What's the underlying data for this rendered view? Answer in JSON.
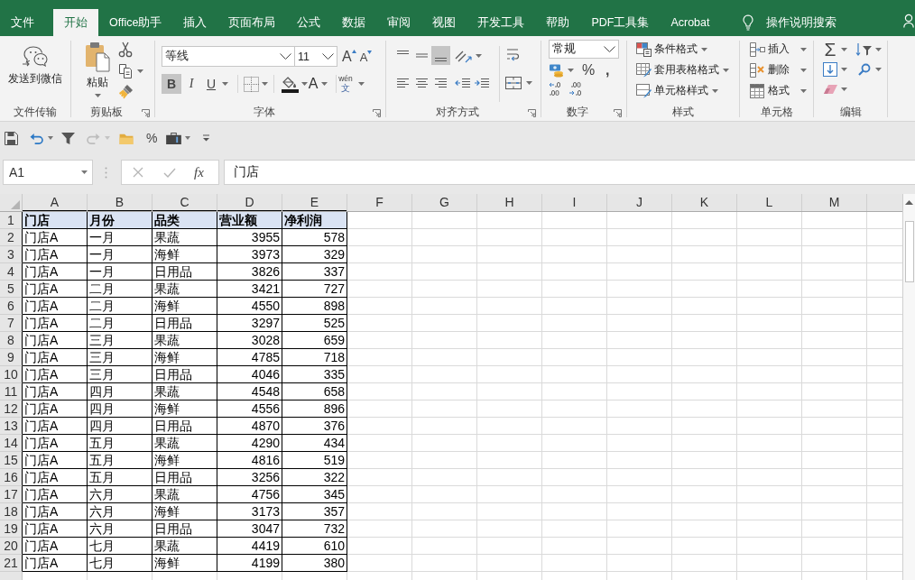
{
  "tabs": [
    {
      "label": "文件",
      "selected": false
    },
    {
      "label": "开始",
      "selected": true
    },
    {
      "label": "Office助手",
      "selected": false
    },
    {
      "label": "插入",
      "selected": false
    },
    {
      "label": "页面布局",
      "selected": false
    },
    {
      "label": "公式",
      "selected": false
    },
    {
      "label": "数据",
      "selected": false
    },
    {
      "label": "审阅",
      "selected": false
    },
    {
      "label": "视图",
      "selected": false
    },
    {
      "label": "开发工具",
      "selected": false
    },
    {
      "label": "帮助",
      "selected": false
    },
    {
      "label": "PDF工具集",
      "selected": false
    },
    {
      "label": "Acrobat",
      "selected": false
    }
  ],
  "tell_me": {
    "label": "操作说明搜索"
  },
  "ribbon": {
    "file_transfer": {
      "title": "文件传输",
      "send_label": "发送到微信"
    },
    "clipboard": {
      "title": "剪贴板",
      "paste_label": "粘贴"
    },
    "font": {
      "title": "字体",
      "font_name": "等线",
      "font_size": "11",
      "grow_label": "A",
      "shrink_label": "A",
      "format_buttons": [
        {
          "kind": "bold",
          "label": "B",
          "on": true,
          "menu": false
        },
        {
          "kind": "italic",
          "label": "I",
          "on": false,
          "menu": false
        },
        {
          "kind": "underline",
          "label": "U",
          "on": false,
          "menu": true
        }
      ],
      "font_color_label": "A",
      "phonetic": {
        "pinyin": "wén",
        "char": "文"
      }
    },
    "alignment": {
      "title": "对齐方式",
      "vertical": [
        {
          "kind": "top",
          "on": false
        },
        {
          "kind": "middle",
          "on": false
        },
        {
          "kind": "bottom",
          "on": true
        }
      ]
    },
    "number": {
      "title": "数字",
      "format": "常规",
      "percent_label": "%",
      "comma_label": ","
    },
    "styles": {
      "title": "样式",
      "items": [
        {
          "kind": "conditional",
          "label": "条件格式"
        },
        {
          "kind": "table",
          "label": "套用表格格式"
        },
        {
          "kind": "cell",
          "label": "单元格样式"
        }
      ]
    },
    "cells": {
      "title": "单元格",
      "items": [
        {
          "kind": "insert",
          "label": "插入"
        },
        {
          "kind": "delete",
          "label": "删除"
        },
        {
          "kind": "format",
          "label": "格式"
        }
      ]
    },
    "editing": {
      "title": "编辑",
      "sum_label": "Σ"
    }
  },
  "quick_access": {
    "percent_label": "%",
    "redo_disabled": true
  },
  "formula_bar": {
    "name_box": "A1",
    "function_label": "fx",
    "value": "门店",
    "editing": false
  },
  "sheet": {
    "columns": [
      "A",
      "B",
      "C",
      "D",
      "E",
      "F",
      "G",
      "H",
      "I",
      "J",
      "K",
      "L",
      "M"
    ],
    "header": {
      "number": "1",
      "cells": [
        {
          "text": "门店",
          "kind": "text"
        },
        {
          "text": "月份",
          "kind": "text"
        },
        {
          "text": "品类",
          "kind": "text"
        },
        {
          "text": "营业额",
          "kind": "number"
        },
        {
          "text": "净利润",
          "kind": "number"
        }
      ]
    },
    "rows": [
      {
        "number": "2",
        "cells": [
          "门店A",
          "一月",
          "果蔬",
          "3955",
          "578"
        ]
      },
      {
        "number": "3",
        "cells": [
          "门店A",
          "一月",
          "海鲜",
          "3973",
          "329"
        ]
      },
      {
        "number": "4",
        "cells": [
          "门店A",
          "一月",
          "日用品",
          "3826",
          "337"
        ]
      },
      {
        "number": "5",
        "cells": [
          "门店A",
          "二月",
          "果蔬",
          "3421",
          "727"
        ]
      },
      {
        "number": "6",
        "cells": [
          "门店A",
          "二月",
          "海鲜",
          "4550",
          "898"
        ]
      },
      {
        "number": "7",
        "cells": [
          "门店A",
          "二月",
          "日用品",
          "3297",
          "525"
        ]
      },
      {
        "number": "8",
        "cells": [
          "门店A",
          "三月",
          "果蔬",
          "3028",
          "659"
        ]
      },
      {
        "number": "9",
        "cells": [
          "门店A",
          "三月",
          "海鲜",
          "4785",
          "718"
        ]
      },
      {
        "number": "10",
        "cells": [
          "门店A",
          "三月",
          "日用品",
          "4046",
          "335"
        ]
      },
      {
        "number": "11",
        "cells": [
          "门店A",
          "四月",
          "果蔬",
          "4548",
          "658"
        ]
      },
      {
        "number": "12",
        "cells": [
          "门店A",
          "四月",
          "海鲜",
          "4556",
          "896"
        ]
      },
      {
        "number": "13",
        "cells": [
          "门店A",
          "四月",
          "日用品",
          "4870",
          "376"
        ]
      },
      {
        "number": "14",
        "cells": [
          "门店A",
          "五月",
          "果蔬",
          "4290",
          "434"
        ]
      },
      {
        "number": "15",
        "cells": [
          "门店A",
          "五月",
          "海鲜",
          "4816",
          "519"
        ]
      },
      {
        "number": "16",
        "cells": [
          "门店A",
          "五月",
          "日用品",
          "3256",
          "322"
        ]
      },
      {
        "number": "17",
        "cells": [
          "门店A",
          "六月",
          "果蔬",
          "4756",
          "345"
        ]
      },
      {
        "number": "18",
        "cells": [
          "门店A",
          "六月",
          "海鲜",
          "3173",
          "357"
        ]
      },
      {
        "number": "19",
        "cells": [
          "门店A",
          "六月",
          "日用品",
          "3047",
          "732"
        ]
      },
      {
        "number": "20",
        "cells": [
          "门店A",
          "七月",
          "果蔬",
          "4419",
          "610"
        ]
      },
      {
        "number": "21",
        "cells": [
          "门店A",
          "七月",
          "海鲜",
          "4199",
          "380"
        ]
      }
    ]
  }
}
